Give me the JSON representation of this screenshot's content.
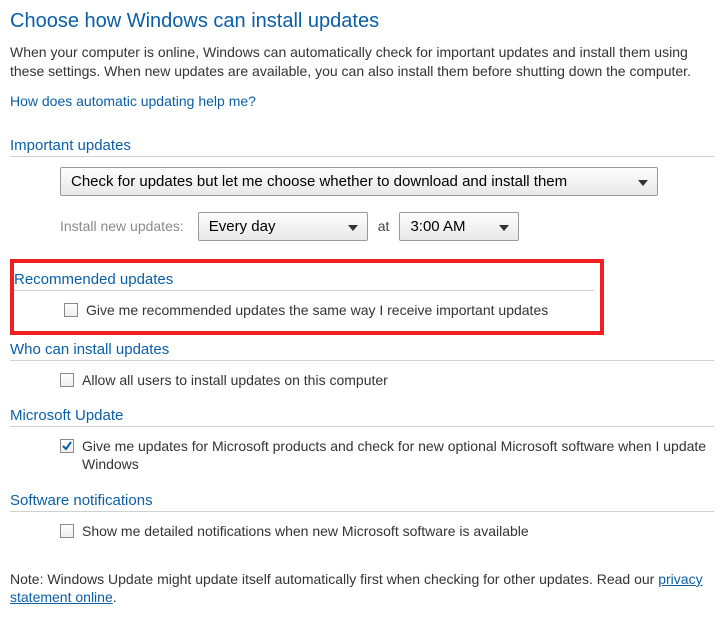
{
  "title": "Choose how Windows can install updates",
  "description": "When your computer is online, Windows can automatically check for important updates and install them using these settings. When new updates are available, you can also install them before shutting down the computer.",
  "help_link": "How does automatic updating help me?",
  "sections": {
    "important": {
      "header": "Important updates",
      "mode_selected": "Check for updates but let me choose whether to download and install them",
      "schedule_label": "Install new updates:",
      "freq_selected": "Every day",
      "at_label": "at",
      "time_selected": "3:00 AM"
    },
    "recommended": {
      "header": "Recommended updates",
      "cb_label": "Give me recommended updates the same way I receive important updates"
    },
    "who": {
      "header": "Who can install updates",
      "cb_label": "Allow all users to install updates on this computer"
    },
    "mu": {
      "header": "Microsoft Update",
      "cb_label": "Give me updates for Microsoft products and check for new optional Microsoft software when I update Windows"
    },
    "notif": {
      "header": "Software notifications",
      "cb_label": "Show me detailed notifications when new Microsoft software is available"
    }
  },
  "note_prefix": "Note: Windows Update might update itself automatically first when checking for other updates.  Read our ",
  "note_link": "privacy statement online",
  "note_suffix": "."
}
